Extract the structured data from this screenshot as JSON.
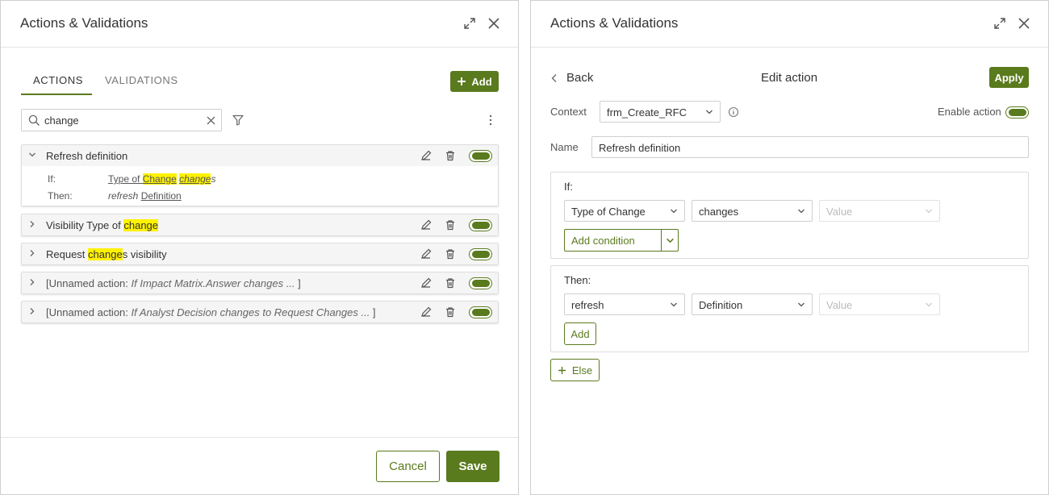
{
  "left": {
    "title": "Actions & Validations",
    "tabs": [
      {
        "label": "ACTIONS",
        "active": true
      },
      {
        "label": "VALIDATIONS",
        "active": false
      }
    ],
    "add_label": "Add",
    "search": {
      "value": "change"
    },
    "actions": [
      {
        "expanded": true,
        "title_parts": [
          "Refresh definition"
        ],
        "if_label": "If:",
        "if_parts": [
          "Type of ",
          "Change",
          " ",
          "change",
          "s"
        ],
        "then_label": "Then:",
        "then_verb": "refresh",
        "then_target": "Definition",
        "enabled": true
      },
      {
        "title_parts": [
          "Visibility Type of ",
          "change"
        ],
        "enabled": true
      },
      {
        "title_parts": [
          "Request ",
          "change",
          "s visibility"
        ],
        "enabled": true
      },
      {
        "title_prefix": "[Unnamed action: ",
        "title_italic": "If Impact Matrix.Answer changes ... ",
        "title_suffix": "]",
        "enabled": true
      },
      {
        "title_prefix": "[Unnamed action: ",
        "title_italic": "If Analyst Decision changes to Request Changes ... ",
        "title_suffix": "]",
        "enabled": true
      }
    ],
    "cancel_label": "Cancel",
    "save_label": "Save"
  },
  "right": {
    "title": "Actions & Validations",
    "back_label": "Back",
    "edit_title": "Edit action",
    "apply_label": "Apply",
    "context_label": "Context",
    "context_value": "frm_Create_RFC",
    "enable_label": "Enable action",
    "enable_on": true,
    "name_label": "Name",
    "name_value": "Refresh definition",
    "if": {
      "label": "If:",
      "field": "Type of Change",
      "operator": "changes",
      "value_placeholder": "Value",
      "add_condition_label": "Add condition"
    },
    "then": {
      "label": "Then:",
      "action": "refresh",
      "target": "Definition",
      "value_placeholder": "Value",
      "add_label": "Add"
    },
    "else_label": "Else"
  },
  "colors": {
    "accent": "#5a7a1e",
    "highlight": "#fff200"
  },
  "icons": [
    "expand-icon",
    "close-icon",
    "plus-icon",
    "search-icon",
    "clear-icon",
    "filter-icon",
    "more-icon",
    "chevron-down-icon",
    "chevron-right-icon",
    "edit-icon",
    "delete-icon",
    "info-icon",
    "back-chevron-icon",
    "caret-down-icon"
  ]
}
